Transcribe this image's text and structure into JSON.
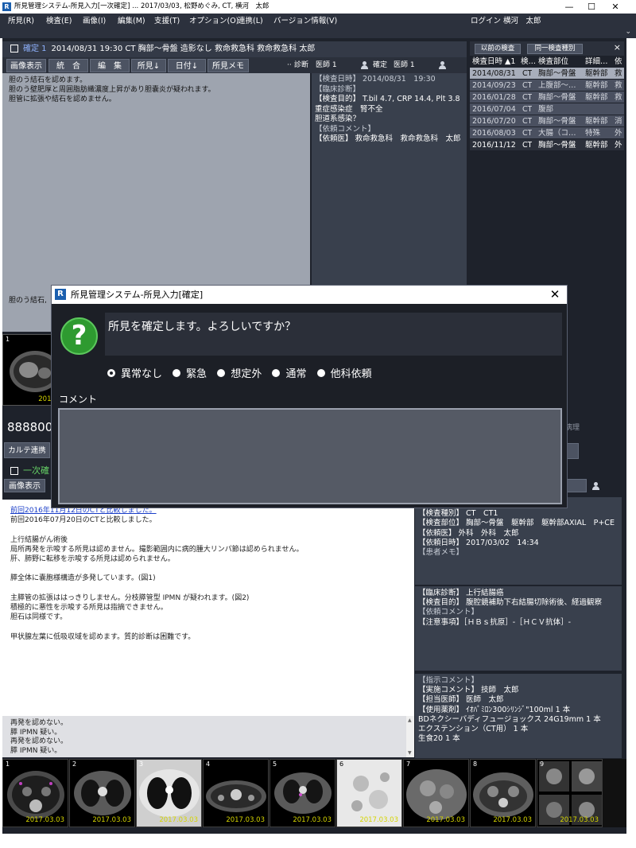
{
  "window": {
    "title": "所見管理システム-所見入力[一次確定] ... 2017/03/03, 松野めぐみ, CT, 横河　太郎",
    "icon": "R",
    "controls": [
      "—",
      "☐",
      "✕"
    ]
  },
  "menu": {
    "items": [
      "所見(R)",
      "検査(E)",
      "画像(I)",
      "編集(M)",
      "支援(T)",
      "オプション(O)",
      "連携(L)",
      "バージョン情報(V)"
    ],
    "login": "ログイン 横河　太郎"
  },
  "record": {
    "status": "確定 1",
    "header_text": "2014/08/31 19:30 CT 胸部～骨盤 造影なし 救命救急科 救命救急科 太郎",
    "toolbar": [
      "画像表示",
      "統　合",
      "編　集",
      "所見↓",
      "日付↓",
      "所見メモ"
    ],
    "diag_label": "診断",
    "doctor1": "医師 1",
    "confirm_label": "確定",
    "doctor2": "医師 1",
    "report_lines": [
      "胆のう結石を認めます。",
      "胆のう壁肥厚と周囲脂肪織濃度上昇があり胆嚢炎が疑われます。",
      "",
      "胆管に拡張や結石を認めません。"
    ],
    "report_tail": "胆のう結石,",
    "info_lines": [
      "【検査日時】 2014/08/31　19:30",
      "【臨床診断】",
      "【検査目的】 T.bil 4.7, CRP 14.4, Plt  3.8",
      "重症感染症　腎不全",
      "胆道系感染？",
      "【依頼コメント】",
      "【依頼医】 救命救急科　救命救急科　太郎"
    ],
    "thumb": {
      "num": "1",
      "date": "2014.0"
    }
  },
  "history": {
    "buttons": [
      "以前の検査",
      "同一検査種別"
    ],
    "headers": [
      "検査日時 ▲1",
      "検…",
      "検査部位",
      "詳細…",
      "依"
    ],
    "rows": [
      [
        "2014/08/31",
        "CT",
        "胸部～骨盤",
        "躯幹部",
        "救"
      ],
      [
        "2014/09/23",
        "CT",
        "上腹部～…",
        "躯幹部",
        "救"
      ],
      [
        "2016/01/28",
        "CT",
        "胸部～骨盤",
        "躯幹部",
        "救"
      ],
      [
        "2016/07/04",
        "CT",
        "腹部",
        "",
        ""
      ],
      [
        "2016/07/20",
        "CT",
        "胸部～骨盤",
        "躯幹部",
        "消"
      ],
      [
        "2016/08/03",
        "CT",
        "大腸（コ…",
        "特殊",
        "外"
      ],
      [
        "2016/11/12",
        "CT",
        "胸部～骨盤",
        "躯幹部",
        "外"
      ]
    ]
  },
  "modal": {
    "title": "所見管理システム-所見入力[確定]",
    "message": "所見を確定します。よろしいですか？",
    "options": [
      "異常なし",
      "緊急",
      "想定外",
      "通常",
      "他科依頼"
    ],
    "selected": 0,
    "comment_label": "コメント",
    "comment_value": ""
  },
  "patient": {
    "id": "888800",
    "karte_button": "カルテ連携",
    "bottom_status": "一次確",
    "image_button": "画像表示",
    "pathology_label": "病理"
  },
  "report2": {
    "lines": [
      {
        "text": "前回2016年11月12日のCTと比較しました。",
        "link": true
      },
      {
        "text": "前回2016年07月20日のCTと比較しました。",
        "link": false
      },
      {
        "text": "",
        "link": false
      },
      {
        "text": "上行結腸がん術後",
        "link": false
      },
      {
        "text": "局所再発を示唆する所見は認めません。撮影範囲内に病的腫大リンパ節は認められません。",
        "link": false
      },
      {
        "text": "肝、肺野に転移を示唆する所見は認められません。",
        "link": false
      },
      {
        "text": "",
        "link": false
      },
      {
        "text": "膵全体に嚢胞様構造が多発しています。(図1)",
        "link": false
      },
      {
        "text": "",
        "link": false
      },
      {
        "text": "主膵管の拡張ははっきりしません。分枝膵管型 IPMN が疑われます。(図2)",
        "link": false
      },
      {
        "text": "積極的に悪性を示唆する所見は指摘できません。",
        "link": false
      },
      {
        "text": "胆石は同様です。",
        "link": false
      },
      {
        "text": "",
        "link": false
      },
      {
        "text": "甲状腺左葉に低吸収域を認めます。質的診断は困難です。",
        "link": false
      }
    ],
    "summary": [
      "再発を認めない。",
      "膵 IPMN 疑い。",
      "再発を認めない。",
      "膵 IPMN 疑い。"
    ]
  },
  "exam_info": {
    "a": [
      "【検査日時】 2017/03/03　14:34",
      "【検査種別】 CT　CT1",
      "【検査部位】 胸部～骨盤　躯幹部　躯幹部AXIAL　P+CE",
      "【依頼医】 外科　外科　太郎",
      "【依頼日時】 2017/03/02　14:34",
      "【患者メモ】"
    ],
    "b": [
      "【臨床診断】 上行結腸癌",
      "【検査目的】 腹腔鏡補助下右結腸切除術後、経過観察",
      "【依頼コメント】",
      "【注意事項】［ＨＢｓ抗原］-［ＨＣＶ抗体］-"
    ],
    "c": [
      "【指示コメント】",
      "【実施コメント】 技師　太郎",
      "【担当医師】 医師　太郎",
      "【使用薬剤】 ｲｵﾊﾟﾐﾛﾝ300ｼﾘﾝｼﾞ\"100ml 1 本",
      "BDネクシーバディフュージョックス 24G19mm 1 本",
      "エクステンション（CT用） 1 本",
      "生食20 1 本"
    ]
  },
  "thumbnails": [
    {
      "num": "1",
      "date": "2017.03.03"
    },
    {
      "num": "2",
      "date": "2017.03.03"
    },
    {
      "num": "3",
      "date": "2017.03.03"
    },
    {
      "num": "4",
      "date": "2017.03.03"
    },
    {
      "num": "5",
      "date": "2017.03.03"
    },
    {
      "num": "6",
      "date": "2017.03.03"
    },
    {
      "num": "7",
      "date": "2017.03.03"
    },
    {
      "num": "8",
      "date": "2017.03.03"
    },
    {
      "num": "9",
      "date": "2017.03.03"
    }
  ]
}
